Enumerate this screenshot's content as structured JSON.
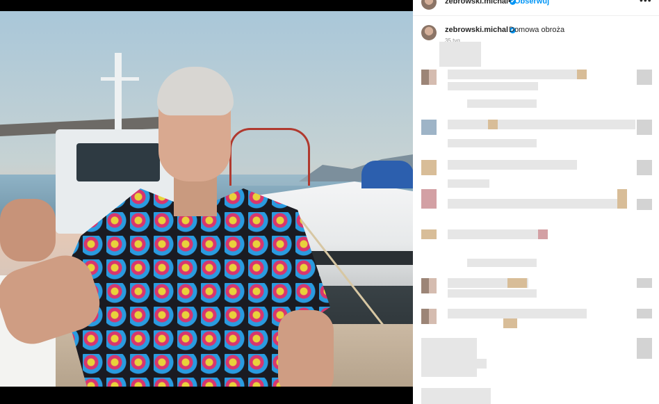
{
  "post": {
    "username": "zebrowski.michal",
    "verified_mark": "✔",
    "separator": "•",
    "follow_label": "Obserwuj",
    "more_label": "•••",
    "caption": "Domowa obroża",
    "time_ago": "35 tyg."
  },
  "colors": {
    "follow_blue": "#0095f6",
    "text_dark": "#262626",
    "muted": "#8e8e8e"
  },
  "icons": [
    "verified-icon",
    "more-options-icon",
    "avatar"
  ]
}
